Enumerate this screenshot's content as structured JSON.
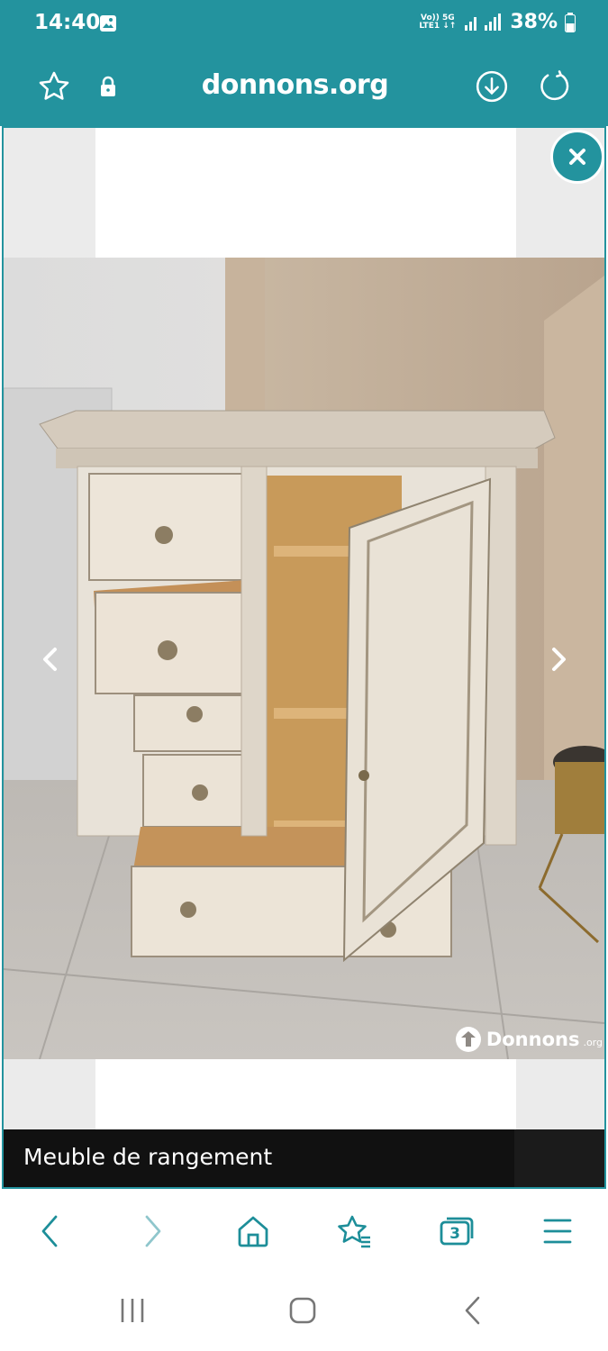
{
  "status_bar": {
    "time": "14:40",
    "network_top": "Vo)) 5G",
    "network_bottom": "LTE1 ↓↑",
    "battery": "38%"
  },
  "browser": {
    "url": "donnons.org",
    "accent_color": "#23939e"
  },
  "viewer": {
    "caption": "Meuble de rangement",
    "watermark_brand": "Donnons",
    "watermark_suffix": ".org"
  },
  "bottom_nav": {
    "tab_count": "3"
  },
  "icons": [
    "image-icon",
    "star-icon",
    "lock-icon",
    "download-icon",
    "reload-icon",
    "close-icon",
    "chevron-left-icon",
    "chevron-right-icon",
    "back-icon",
    "forward-icon",
    "home-icon",
    "bookmarks-icon",
    "tabs-icon",
    "menu-icon",
    "recents-icon",
    "home-button-icon",
    "system-back-icon"
  ]
}
